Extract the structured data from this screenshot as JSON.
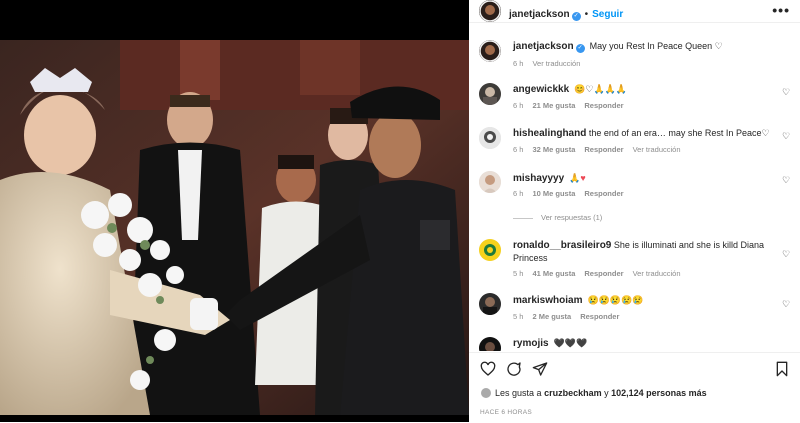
{
  "post": {
    "author": "janetjackson",
    "follow_label": "Seguir",
    "dot": "•",
    "more": "•••"
  },
  "caption": {
    "author": "janetjackson",
    "text": "May you Rest In Peace Queen ♡",
    "time": "6 h",
    "translate": "Ver traducción"
  },
  "comments": [
    {
      "user": "angewickkk",
      "text": "😊♡🙏🙏🙏",
      "time": "6 h",
      "likes": "21 Me gusta",
      "reply": "Responder",
      "translate": ""
    },
    {
      "user": "hishealinghand",
      "text": "the end of an era… may she Rest In Peace♡",
      "time": "6 h",
      "likes": "32 Me gusta",
      "reply": "Responder",
      "translate": "Ver traducción"
    },
    {
      "user": "mishayyyy",
      "text": "🙏♥",
      "time": "6 h",
      "likes": "10 Me gusta",
      "reply": "Responder",
      "translate": ""
    },
    {
      "user": "ronaldo__brasileiro9",
      "text": "She is illuminati and she is killd Diana Princess",
      "time": "5 h",
      "likes": "41 Me gusta",
      "reply": "Responder",
      "translate": "Ver traducción"
    },
    {
      "user": "markiswhoiam",
      "text": "😢😢😢😢😢",
      "time": "5 h",
      "likes": "2 Me gusta",
      "reply": "Responder",
      "translate": ""
    },
    {
      "user": "rymojis",
      "text": "🖤🖤🖤",
      "time": "",
      "likes": "",
      "reply": "",
      "translate": ""
    }
  ],
  "view_replies": "Ver respuestas (1)",
  "likes_line": {
    "prefix": "Les gusta a",
    "user": "cruzbeckham",
    "joiner": "y",
    "count": "102,124 personas más"
  },
  "timestamp": "HACE 6 HORAS",
  "colors": {
    "accent": "#0095f6",
    "verified": "#3897f0",
    "heart_red": "#ed4956"
  }
}
